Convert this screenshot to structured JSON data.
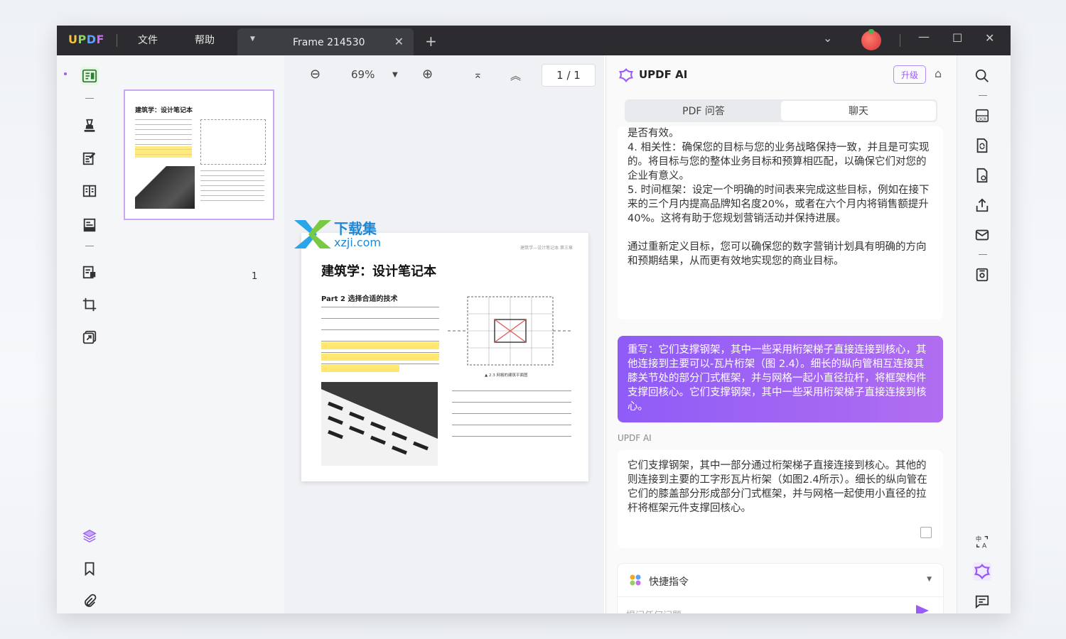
{
  "titlebar": {
    "logo": "UPDF",
    "menu_file": "文件",
    "menu_help": "帮助",
    "tab_name": "Frame 214530"
  },
  "toolbar": {
    "zoom": "69%",
    "page_indicator": "1 / 1"
  },
  "thumbnails": {
    "page_number": "1"
  },
  "document": {
    "title": "建筑学：设计笔记本",
    "section": "Part 2  选择合适的技术",
    "header_small": "建筑学—设计笔记本 第三章",
    "figure_caption": "▲ 2.3 网格的建筑平面图",
    "thumb_title": "建筑学：设计笔记本"
  },
  "ai": {
    "title": "UPDF AI",
    "upgrade": "升级",
    "tab_pdf": "PDF 问答",
    "tab_chat": "聊天",
    "history_lines": [
      "是否有效。",
      "4. 相关性：确保您的目标与您的业务战略保持一致，并且是可实现的。将目标与您的整体业务目标和预算相匹配，以确保它们对您的企业有意义。",
      "5. 时间框架：设定一个明确的时间表来完成这些目标，例如在接下来的三个月内提高品牌知名度20%，或者在六个月内将销售额提升40%。这将有助于您规划营销活动并保持进展。",
      "",
      "通过重新定义目标，您可以确保您的数字营销计划具有明确的方向和预期结果，从而更有效地实现您的商业目标。"
    ],
    "user_prompt": "重写：它们支撑钢架，其中一些采用桁架梯子直接连接到核心，其他连接到主要可以-瓦片桁架（图 2.4）。细长的纵向管相互连接其膝关节处的部分门式框架，并与网格一起小直径拉杆，将框架构件支撑回核心。它们支撑钢架，其中一些采用桁架梯子直接连接到核心。",
    "ai_label": "UPDF AI",
    "ai_reply": "它们支撑钢架，其中一部分通过桁架梯子直接连接到核心。其他的则连接到主要的工字形瓦片桁架（如图2.4所示）。细长的纵向管在它们的膝盖部分形成部分门式框架，并与网格一起使用小直径的拉杆将框架元件支撑回核心。",
    "quick_cmd": "快捷指令",
    "input_placeholder": "提问任何问题..."
  },
  "watermark": {
    "cn": "下载集",
    "url": "xzji.com"
  },
  "colors": {
    "accent": "#9b5cf6",
    "highlight": "#ffe14d",
    "titlebar": "#2b2b30"
  }
}
